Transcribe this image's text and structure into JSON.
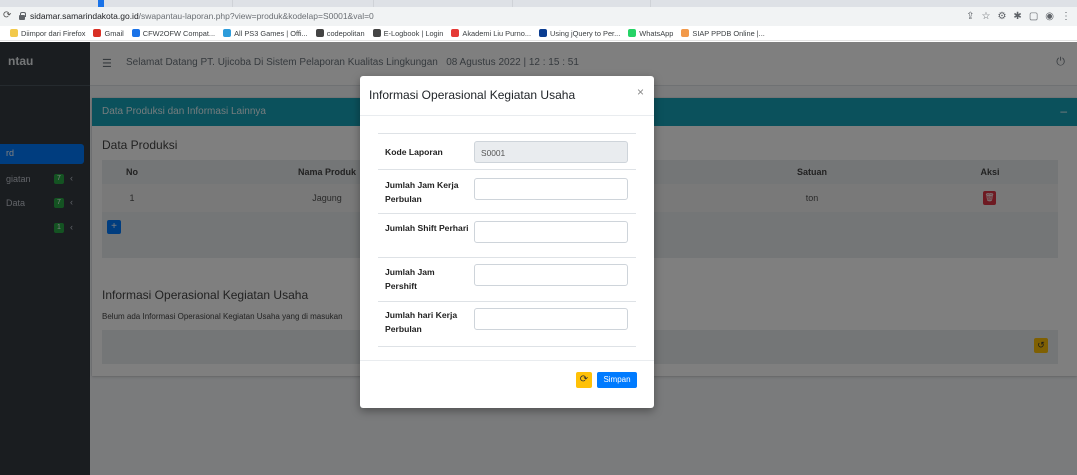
{
  "browser": {
    "url_host": "sidamar.samarindakota.go.id",
    "url_path": "/swapantau-laporan.php?view=produk&kodelap=S0001&val=0",
    "bookmarks": [
      {
        "label": "Diimpor dari Firefox",
        "icon": "folder-icon",
        "color": "#f2c94c"
      },
      {
        "label": "Gmail",
        "icon": "gmail-icon",
        "color": "#d93025"
      },
      {
        "label": "CFW2OFW Compat...",
        "icon": "cfw-icon",
        "color": "#1a73e8"
      },
      {
        "label": "All PS3 Games | Offi...",
        "icon": "ps3-icon",
        "color": "#2d9cdb"
      },
      {
        "label": "codepolitan",
        "icon": "globe-icon",
        "color": "#444444"
      },
      {
        "label": "E-Logbook | Login",
        "icon": "globe-icon",
        "color": "#444444"
      },
      {
        "label": "Akademi Liu Purno...",
        "icon": "akademi-icon",
        "color": "#e53935"
      },
      {
        "label": "Using jQuery to Per...",
        "icon": "jquery-icon",
        "color": "#0b3d91"
      },
      {
        "label": "WhatsApp",
        "icon": "whatsapp-icon",
        "color": "#25d366"
      },
      {
        "label": "SIAP PPDB Online |...",
        "icon": "siap-icon",
        "color": "#f2994a"
      }
    ]
  },
  "sidebar": {
    "brand": "ntau",
    "items": [
      {
        "label": "rd",
        "active": true
      },
      {
        "label": "giatan",
        "badge": "7"
      },
      {
        "label": "Data",
        "badge": "7"
      },
      {
        "label": "",
        "badge": "1"
      }
    ]
  },
  "topnav": {
    "welcome": "Selamat Datang PT. Ujicoba Di Sistem Pelaporan Kualitas Lingkungan",
    "date": "08 Agustus 2022 | 12 : 15 : 51"
  },
  "card": {
    "header": "Data Produksi dan Informasi Lainnya",
    "produksi_title": "Data Produksi",
    "columns": {
      "no": "No",
      "nama": "Nama Produk",
      "satuan": "Satuan",
      "aksi": "Aksi"
    },
    "rows": [
      {
        "no": "1",
        "nama": "Jagung",
        "satuan": "ton"
      }
    ],
    "info_title": "Informasi Operasional Kegiatan Usaha",
    "info_note": "Belum ada Informasi Operasional Kegiatan Usaha yang di masukan"
  },
  "modal": {
    "title": "Informasi Operasional Kegiatan Usaha",
    "close": "×",
    "fields": [
      {
        "label": "Kode Laporan",
        "value": "S0001",
        "readonly": true
      },
      {
        "label": "Jumlah Jam Kerja Perbulan",
        "value": ""
      },
      {
        "label": "Jumlah Shift Perhari",
        "value": ""
      },
      {
        "label": "Jumlah Jam Pershift",
        "value": ""
      },
      {
        "label": "Jumlah hari Kerja Perbulan",
        "value": ""
      }
    ],
    "save_label": "Simpan"
  },
  "colors": {
    "primary": "#007bff",
    "info": "#17a2b8",
    "warning": "#ffc107",
    "danger": "#dc3545",
    "sidebar": "#343a40",
    "badge": "#28a745"
  }
}
